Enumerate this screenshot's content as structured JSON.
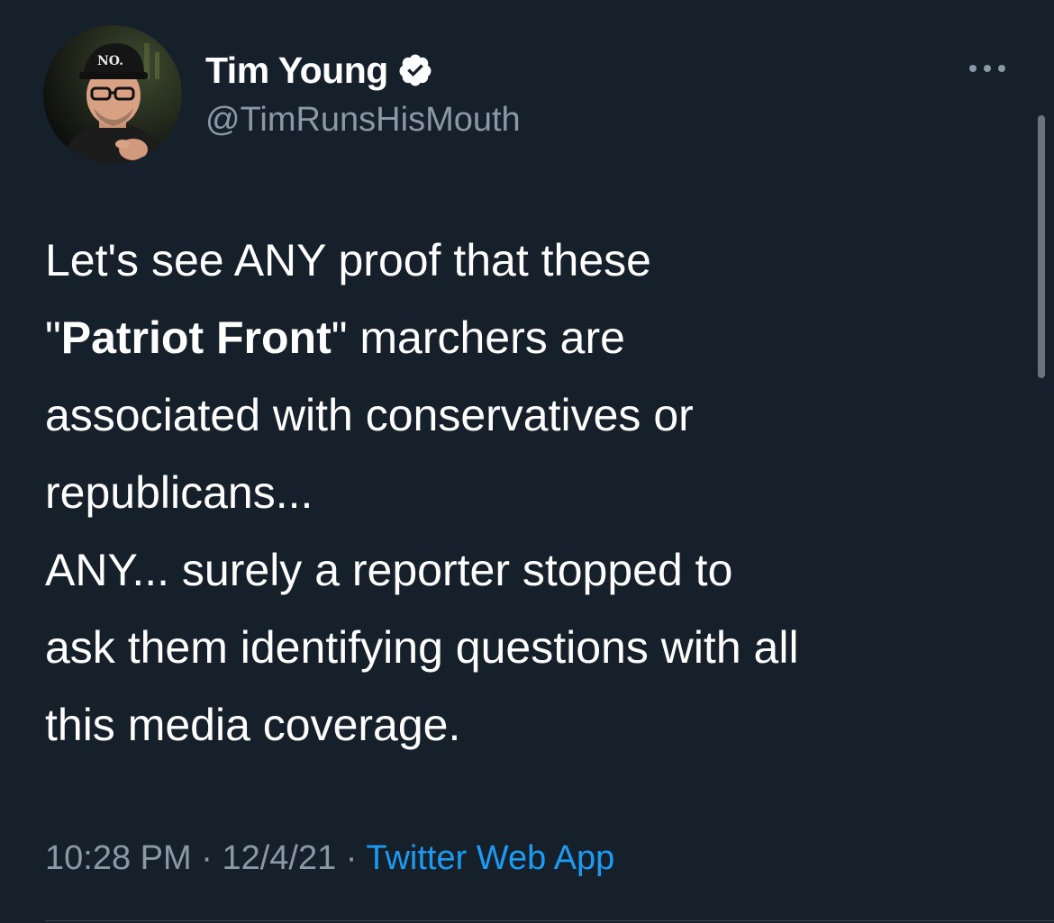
{
  "author": {
    "name": "Tim Young",
    "handle": "@TimRunsHisMouth",
    "avatar_hat_text": "NO."
  },
  "tweet": {
    "line1": "Let's see ANY proof that these",
    "quote_open": "\"",
    "bold_phrase": "Patriot Front",
    "quote_close_rest": "\" marchers are",
    "line3": "associated with conservatives or",
    "line4": "republicans...",
    "para2_line1": "ANY... surely a reporter stopped to",
    "para2_line2": "ask them identifying questions with all",
    "para2_line3": "this media coverage."
  },
  "meta": {
    "time": "10:28 PM",
    "separator": " · ",
    "date": "12/4/21",
    "source": "Twitter Web App"
  },
  "colors": {
    "background": "#15202b",
    "secondary_text": "#8b98a5",
    "link": "#1d9bf0"
  },
  "icons": [
    "verified-badge-icon",
    "more-options-icon"
  ]
}
